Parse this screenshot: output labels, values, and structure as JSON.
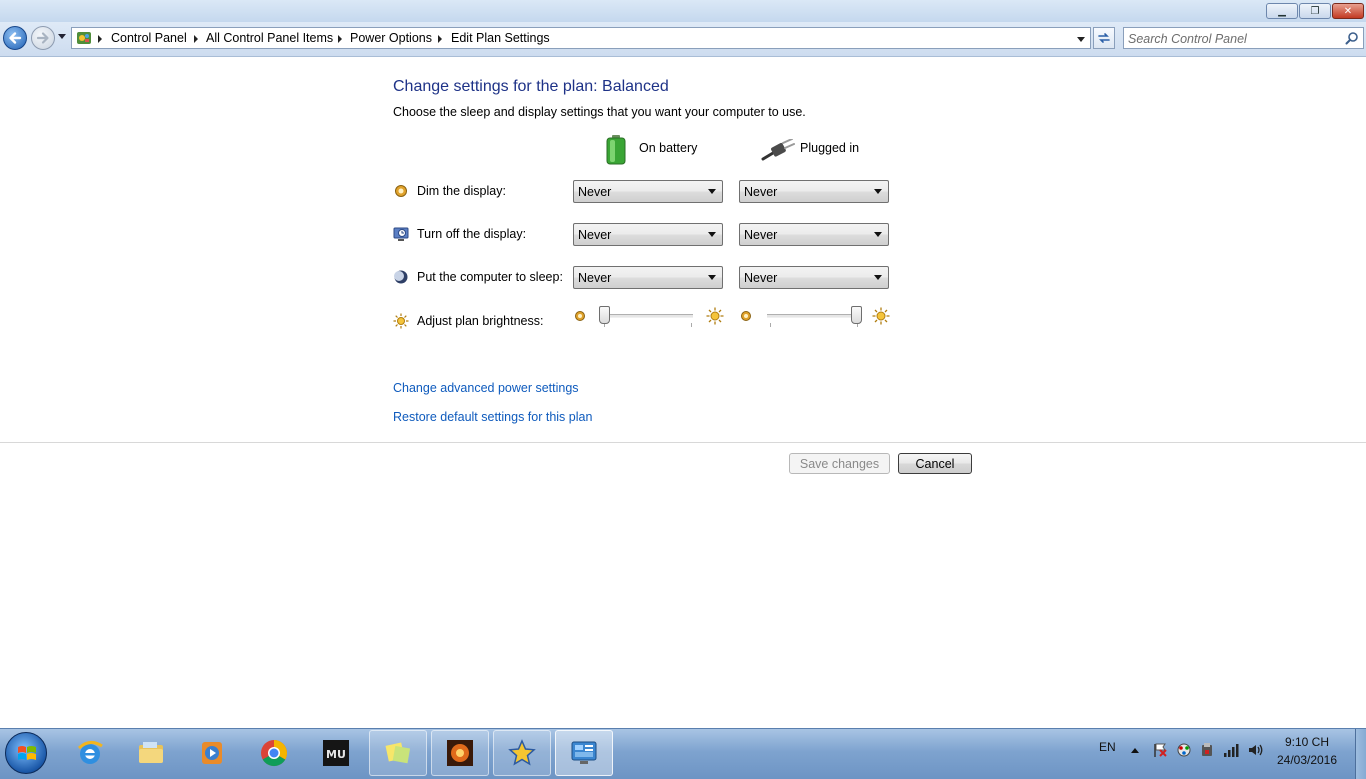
{
  "window": {
    "minimize_glyph": "▁",
    "maximize_glyph": "❐",
    "close_glyph": "✕"
  },
  "navigation": {
    "breadcrumbs": [
      "Control Panel",
      "All Control Panel Items",
      "Power Options",
      "Edit Plan Settings"
    ],
    "search_placeholder": "Search Control Panel"
  },
  "main": {
    "title": "Change settings for the plan: Balanced",
    "description": "Choose the sleep and display settings that you want your computer to use.",
    "columns": {
      "battery": "On battery",
      "plugged": "Plugged in"
    },
    "rows": [
      {
        "label": "Dim the display:",
        "icon": "dim-display-icon",
        "battery": "Never",
        "plugged": "Never"
      },
      {
        "label": "Turn off the display:",
        "icon": "monitor-clock-icon",
        "battery": "Never",
        "plugged": "Never"
      },
      {
        "label": "Put the computer to sleep:",
        "icon": "moon-icon",
        "battery": "Never",
        "plugged": "Never"
      }
    ],
    "brightness": {
      "label": "Adjust plan brightness:",
      "battery_level_percent": 0,
      "plugged_level_percent": 100
    },
    "links": {
      "advanced": "Change advanced power settings",
      "restore": "Restore default settings for this plan"
    },
    "buttons": {
      "save": "Save changes",
      "cancel": "Cancel"
    }
  },
  "taskbar": {
    "apps": [
      "internet-explorer-icon",
      "file-explorer-icon",
      "media-player-icon",
      "chrome-icon",
      "mu-game-icon",
      "sticky-notes-icon",
      "game-launcher-icon",
      "star-app-icon",
      "control-panel-icon"
    ],
    "language": "EN",
    "clock_time": "9:10 CH",
    "clock_date": "24/03/2016"
  },
  "colors": {
    "title_blue": "#1e3287",
    "link_blue": "#0f5bbd",
    "taskbar": "#7ea3cf"
  }
}
